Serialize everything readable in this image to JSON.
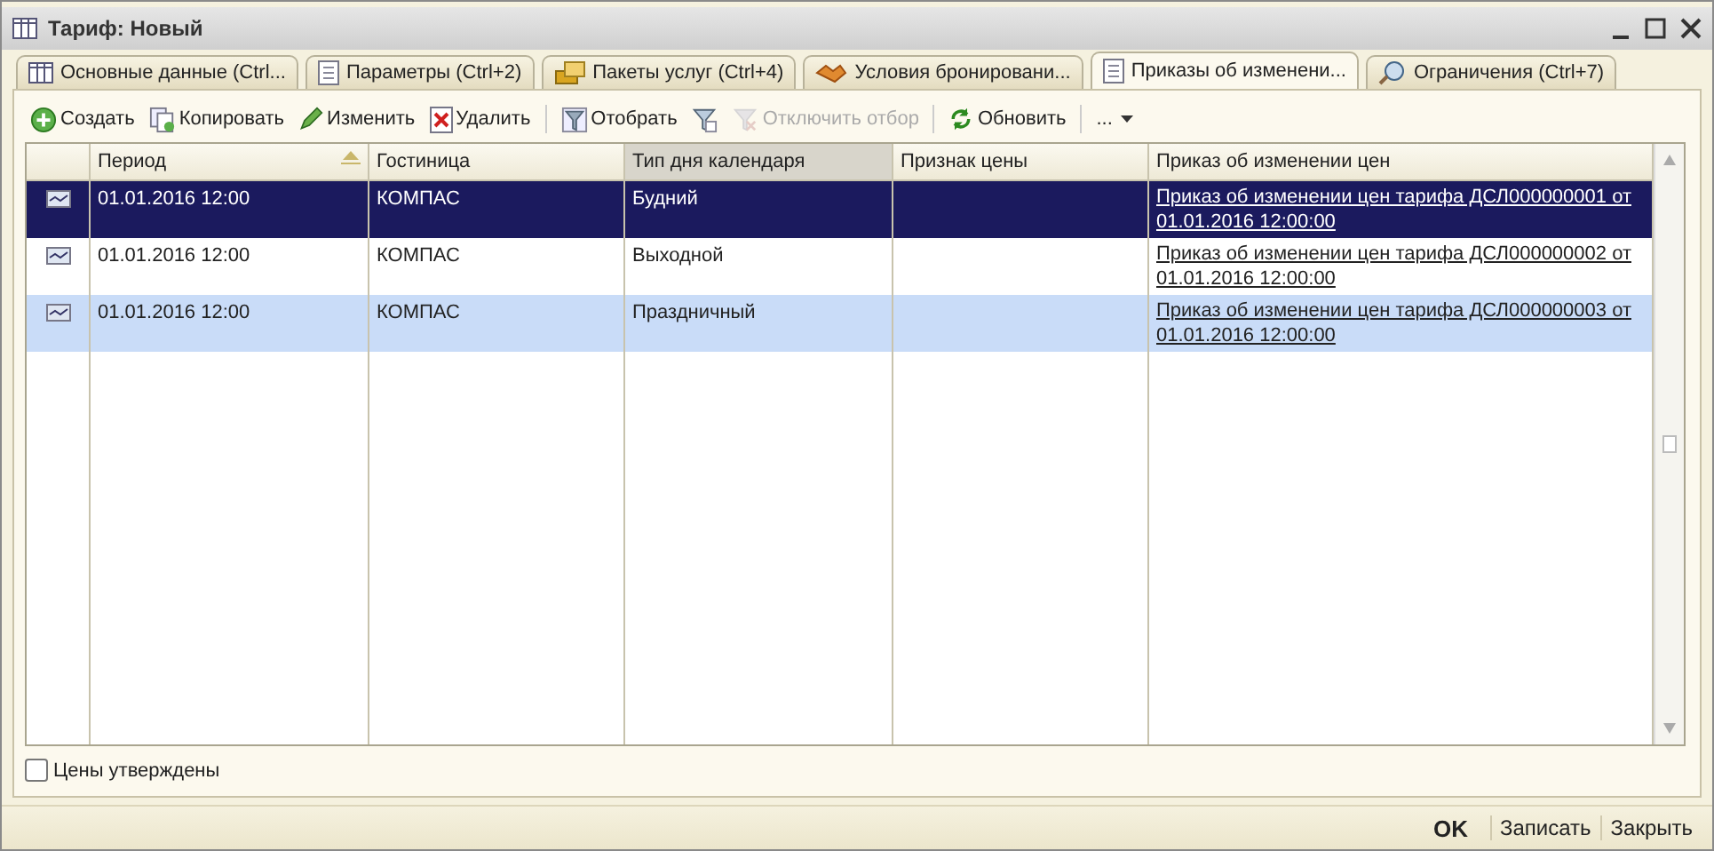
{
  "window": {
    "title": "Тариф: Новый"
  },
  "tabs": [
    {
      "label": "Основные данные (Ctrl...",
      "selected": false
    },
    {
      "label": "Параметры (Ctrl+2)",
      "selected": false
    },
    {
      "label": "Пакеты услуг (Ctrl+4)",
      "selected": false
    },
    {
      "label": "Условия бронировани...",
      "selected": false
    },
    {
      "label": "Приказы об изменени...",
      "selected": true
    },
    {
      "label": "Ограничения (Ctrl+7)",
      "selected": false
    }
  ],
  "toolbar": [
    [
      {
        "label": "Создать",
        "disabled": false
      },
      {
        "label": "Копировать",
        "disabled": false
      },
      {
        "label": "Изменить",
        "disabled": false
      },
      {
        "label": "Удалить",
        "disabled": false
      }
    ],
    [
      {
        "label": "Отобрать",
        "disabled": false
      },
      {
        "disabled": false
      },
      {
        "label": "Отключить отбор",
        "disabled": true
      }
    ],
    [
      {
        "label": "Обновить",
        "disabled": false
      }
    ],
    [
      {
        "label": "...",
        "disabled": false
      }
    ]
  ],
  "table": {
    "columns": [
      {
        "label": "Период",
        "sorted": true,
        "current": false
      },
      {
        "label": "Гостиница",
        "sorted": false,
        "current": false
      },
      {
        "label": "Тип дня календаря",
        "sorted": false,
        "current": true
      },
      {
        "label": "Признак цены",
        "sorted": false,
        "current": false
      },
      {
        "label": "Приказ об изменении цен",
        "sorted": false,
        "current": false
      }
    ],
    "rows": [
      {
        "selected": true,
        "cells": [
          "01.01.2016 12:00",
          "КОМПАС",
          "Будний",
          "",
          "Приказ об изменении цен тарифа ДСЛ000000001 от 01.01.2016 12:00:00"
        ]
      },
      {
        "selected": false,
        "cells": [
          "01.01.2016 12:00",
          "КОМПАС",
          "Выходной",
          "",
          "Приказ об изменении цен тарифа ДСЛ000000002 от 01.01.2016 12:00:00"
        ]
      },
      {
        "selected": false,
        "cells": [
          "01.01.2016 12:00",
          "КОМПАС",
          "Праздничный",
          "",
          "Приказ об изменении цен тарифа ДСЛ000000003 от 01.01.2016 12:00:00"
        ]
      }
    ]
  },
  "approved": {
    "label": "Цены утверждены",
    "checked": false
  },
  "buttons": [
    {
      "label": "OK",
      "default": true
    },
    {
      "label": "Записать",
      "default": false
    },
    {
      "label": "Закрыть",
      "default": false
    }
  ]
}
